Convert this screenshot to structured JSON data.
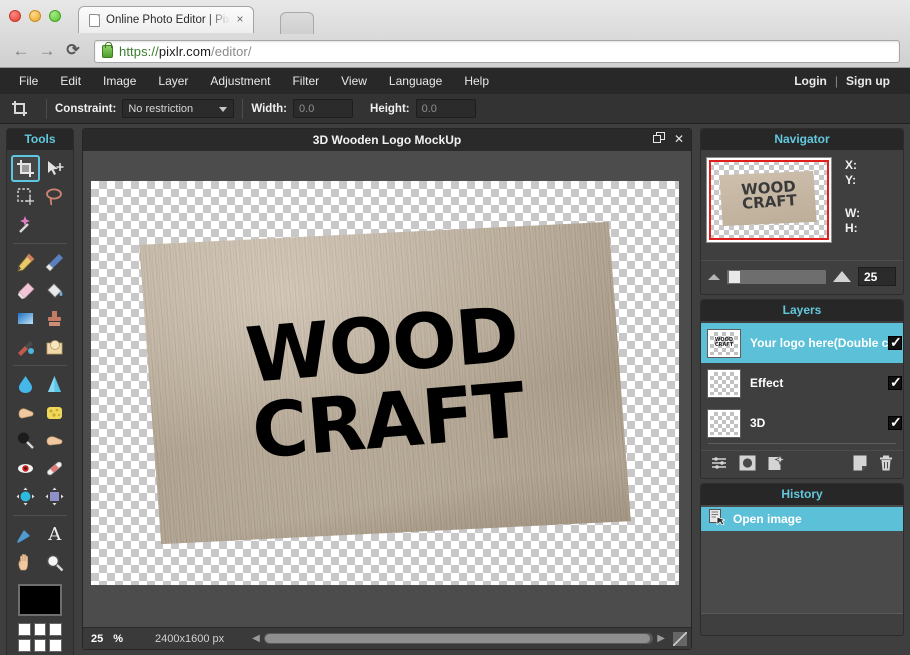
{
  "browser": {
    "tab": {
      "title": "Online Photo Editor | Pixlr",
      "close": "×",
      "favicon_name": "page-icon"
    },
    "nav": {
      "back": "←",
      "forward": "→",
      "reload": "⟳"
    },
    "url": {
      "scheme": "https://",
      "host": "pixlr.com",
      "path": "/editor/",
      "lock_icon": "lock-icon"
    }
  },
  "menubar": {
    "items": [
      {
        "label": "File"
      },
      {
        "label": "Edit"
      },
      {
        "label": "Image"
      },
      {
        "label": "Layer"
      },
      {
        "label": "Adjustment"
      },
      {
        "label": "Filter"
      },
      {
        "label": "View"
      },
      {
        "label": "Language"
      },
      {
        "label": "Help"
      }
    ],
    "login": "Login",
    "separator": "|",
    "signup": "Sign up"
  },
  "options_bar": {
    "tool_icon": "crop-tool-icon",
    "constraint_label": "Constraint:",
    "constraint_value": "No restriction",
    "width_label": "Width:",
    "width_value": "0.0",
    "height_label": "Height:",
    "height_value": "0.0"
  },
  "tools": {
    "title": "Tools",
    "items": [
      {
        "name": "crop-tool",
        "glyph": "✀",
        "selected": true
      },
      {
        "name": "move-tool",
        "glyph": "✦",
        "selected": false
      },
      {
        "name": "marquee-select-tool",
        "glyph": "⬚",
        "selected": false
      },
      {
        "name": "lasso-tool",
        "glyph": "➰",
        "selected": false
      },
      {
        "name": "wand-select-tool",
        "glyph": "✨",
        "selected": false
      },
      {
        "name": "pencil-tool",
        "glyph": "✏",
        "selected": false
      },
      {
        "name": "brush-tool",
        "glyph": "🖌",
        "selected": false
      },
      {
        "name": "eraser-tool",
        "glyph": "▱",
        "selected": false
      },
      {
        "name": "paint-bucket-tool",
        "glyph": "🪣",
        "selected": false
      },
      {
        "name": "gradient-tool",
        "glyph": "▤",
        "selected": false
      },
      {
        "name": "clone-stamp-tool",
        "glyph": "⚓",
        "selected": false
      },
      {
        "name": "color-replace-tool",
        "glyph": "🖊",
        "selected": false
      },
      {
        "name": "drawing-tool",
        "glyph": "◔",
        "selected": false
      },
      {
        "name": "blur-tool",
        "glyph": "💧",
        "selected": false
      },
      {
        "name": "sharpen-tool",
        "glyph": "▲",
        "selected": false
      },
      {
        "name": "smudge-tool",
        "glyph": "👆",
        "selected": false
      },
      {
        "name": "sponge-tool",
        "glyph": "🧽",
        "selected": false
      },
      {
        "name": "dodge-tool",
        "glyph": "⚫",
        "selected": false
      },
      {
        "name": "burn-tool",
        "glyph": "✋",
        "selected": false
      },
      {
        "name": "red-eye-tool",
        "glyph": "👁",
        "selected": false
      },
      {
        "name": "spot-heal-tool",
        "glyph": "🩹",
        "selected": false
      },
      {
        "name": "bloat-tool",
        "glyph": "◉",
        "selected": false
      },
      {
        "name": "pinch-tool",
        "glyph": "◆",
        "selected": false
      },
      {
        "name": "eyedropper-tool",
        "glyph": "💉",
        "selected": false
      },
      {
        "name": "text-tool",
        "glyph": "A",
        "selected": false
      },
      {
        "name": "hand-tool",
        "glyph": "🖐",
        "selected": false
      },
      {
        "name": "zoom-tool",
        "glyph": "🔍",
        "selected": false
      }
    ],
    "primary_color": "#000000",
    "swatch_colors": [
      "#ffffff",
      "#ffffff",
      "#ffffff",
      "#ffffff",
      "#ffffff",
      "#ffffff"
    ]
  },
  "document": {
    "title": "3D Wooden Logo MockUp",
    "restore_label": "❐",
    "close_label": "✕",
    "canvas": {
      "logo_line1": "WOOD",
      "logo_line2": "CRAFT",
      "plank_color": "#c6b7a3",
      "text_color": "#000000"
    },
    "status": {
      "zoom": "25",
      "percent": "%",
      "dimensions": "2400x1600 px"
    }
  },
  "navigator": {
    "title": "Navigator",
    "thumb_line1": "WOOD",
    "thumb_line2": "CRAFT",
    "x_label": "X:",
    "y_label": "Y:",
    "w_label": "W:",
    "h_label": "H:",
    "x_value": "",
    "y_value": "",
    "w_value": "",
    "h_value": "",
    "zoom_value": "25",
    "frame_color": "#e0201a"
  },
  "layers": {
    "title": "Layers",
    "rows": [
      {
        "name": "Your logo here(Double c",
        "visible": true,
        "active": true,
        "thumb_text": "WOOD\nCRAFT"
      },
      {
        "name": "Effect",
        "visible": true,
        "active": false,
        "thumb_text": ""
      },
      {
        "name": "3D",
        "visible": true,
        "active": false,
        "thumb_text": ""
      }
    ],
    "toolbar": [
      {
        "name": "layer-settings-icon",
        "glyph": "☲"
      },
      {
        "name": "layer-mask-icon",
        "glyph": "◉"
      },
      {
        "name": "layer-style-icon",
        "glyph": "✦"
      },
      {
        "name": "new-layer-icon",
        "glyph": "◰"
      },
      {
        "name": "delete-layer-icon",
        "glyph": "🗑"
      }
    ]
  },
  "history": {
    "title": "History",
    "entries": [
      {
        "label": "Open image",
        "active": true,
        "icon": "open-image-icon"
      }
    ]
  },
  "colors": {
    "accent_cyan": "#5bc0d8",
    "panel_title": "#63c8dd",
    "panel_bg": "#3f3f3f",
    "chrome_dark": "#282828"
  }
}
